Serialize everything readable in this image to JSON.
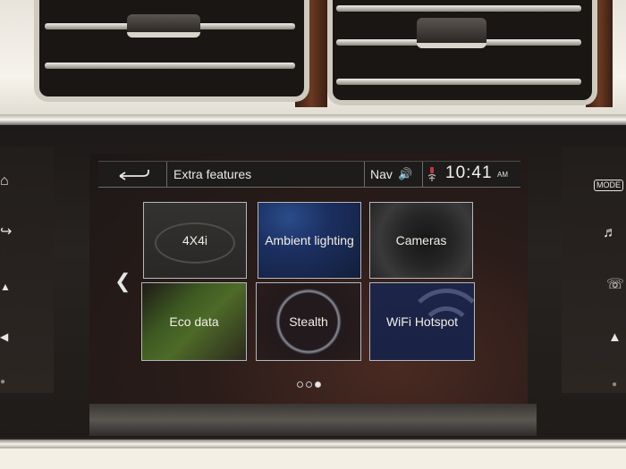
{
  "screen": {
    "title": "Extra features",
    "back_label": "Back",
    "status": {
      "source": "Nav",
      "time": "10:41",
      "ampm": "AM"
    },
    "tiles": [
      {
        "label": "4X4i"
      },
      {
        "label": "Ambient lighting"
      },
      {
        "label": "Cameras"
      },
      {
        "label": "Eco data"
      },
      {
        "label": "Stealth"
      },
      {
        "label": "WiFi Hotspot"
      }
    ],
    "pagination": {
      "total": 3,
      "current": 3
    }
  },
  "side_buttons": {
    "left": [
      "home-icon",
      "exit-icon",
      "hazard-icon",
      "skip-icon",
      "dot-icon"
    ],
    "right": [
      "MODE",
      "media-icon",
      "phone-icon",
      "navigation-icon",
      "dot-icon"
    ]
  },
  "right_mode_label": "MODE"
}
